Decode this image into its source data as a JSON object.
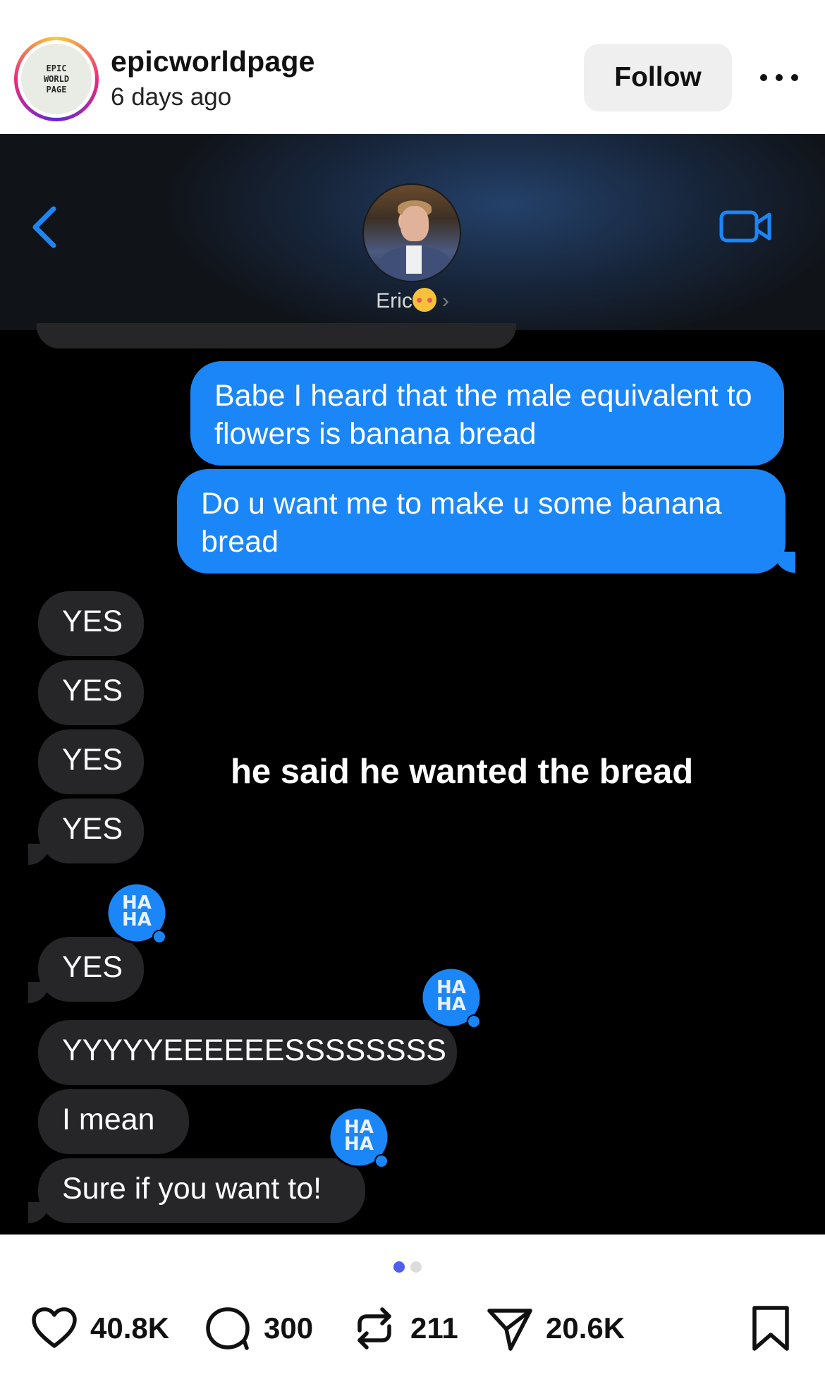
{
  "header": {
    "account_name": "epicworldpage",
    "posted_time": "6 days ago",
    "follow_label": "Follow",
    "avatar_logo_text": "EPIC WORLD PAGE",
    "more_icon": "more-horizontal-icon"
  },
  "conversation": {
    "contact_name": "Eric",
    "contact_emoji": "smiling-face-with-hearts",
    "back_icon": "chevron-left-icon",
    "video_icon": "video-camera-icon",
    "sent_color": "#1b86f7",
    "received_color": "#262628",
    "messages": [
      {
        "from": "me",
        "text": "Babe I heard that the male equivalent to flowers is banana bread"
      },
      {
        "from": "me",
        "text": "Do u want me to make u some banana bread"
      },
      {
        "from": "them",
        "text": "YES"
      },
      {
        "from": "them",
        "text": "YES"
      },
      {
        "from": "them",
        "text": "YES"
      },
      {
        "from": "them",
        "text": "YES"
      },
      {
        "from": "them",
        "text": "YES",
        "reaction": "HA HA"
      },
      {
        "from": "them",
        "text": "YYYYYEEEEEESSSSSSSS",
        "reaction": "HA HA"
      },
      {
        "from": "them",
        "text": "I mean"
      },
      {
        "from": "them",
        "text": "Sure if you want to!",
        "reaction": "HA HA"
      }
    ],
    "overlay_caption": "he said he wanted the bread"
  },
  "carousel": {
    "current": 1,
    "total": 2,
    "active_color": "#4f5df0"
  },
  "actions": {
    "likes": "40.8K",
    "comments": "300",
    "reposts": "211",
    "shares": "20.6K"
  }
}
